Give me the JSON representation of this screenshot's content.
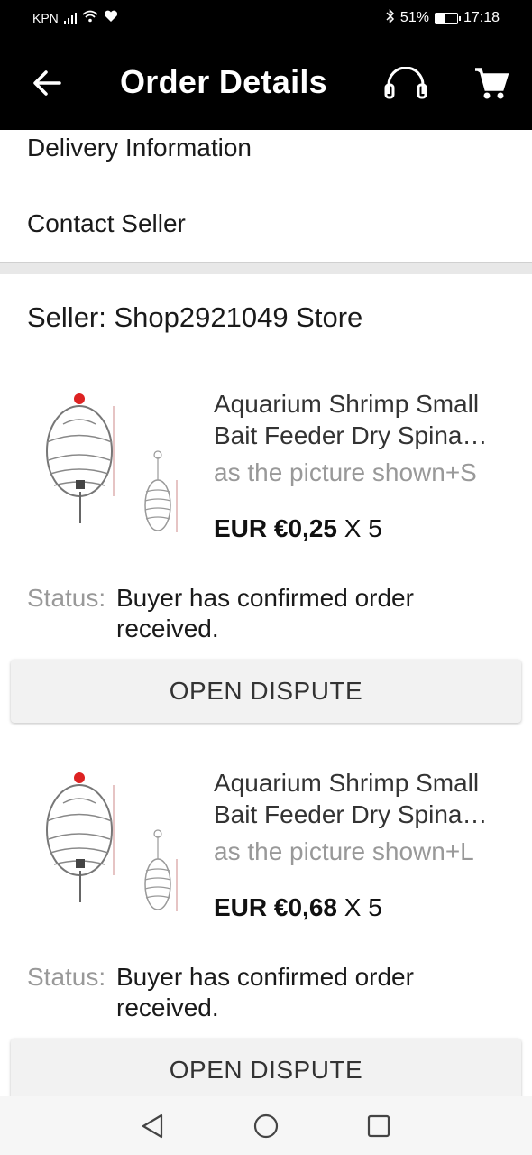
{
  "status_bar": {
    "carrier": "KPN",
    "battery": "51%",
    "battery_level": 0.51,
    "time": "17:18"
  },
  "app_bar": {
    "title": "Order Details",
    "back_icon": "arrow-left-icon",
    "support_icon": "headset-icon",
    "cart_icon": "cart-icon"
  },
  "menu": {
    "delivery_info": "Delivery Information",
    "contact_seller": "Contact Seller"
  },
  "seller": {
    "label": "Seller: Shop2921049 Store"
  },
  "items": [
    {
      "title_line1": "Aquarium Shrimp Small",
      "title_line2": "Bait Feeder Dry Spina…",
      "variant": "as the picture shown+S",
      "price": "EUR €0,25",
      "quantity": " X 5",
      "status_label": "Status:",
      "status_value": "Buyer has confirmed order received.",
      "button_label": "OPEN DISPUTE"
    },
    {
      "title_line1": "Aquarium Shrimp Small",
      "title_line2": "Bait Feeder Dry Spina…",
      "variant": "as the picture shown+L",
      "price": "EUR €0,68",
      "quantity": " X 5",
      "status_label": "Status:",
      "status_value": "Buyer has confirmed order received.",
      "button_label": "OPEN DISPUTE"
    }
  ],
  "nav": {
    "back": "triangle-back-icon",
    "home": "circle-home-icon",
    "recents": "square-recents-icon"
  }
}
